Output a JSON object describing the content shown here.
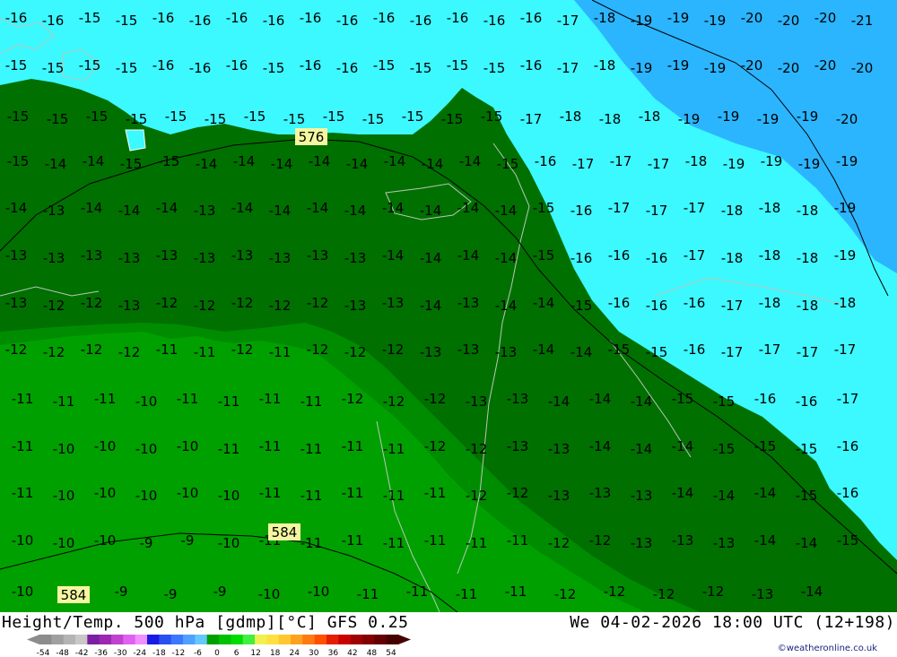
{
  "map": {
    "height_contours": [
      {
        "label": "576"
      },
      {
        "label": "584"
      },
      {
        "label": "584"
      }
    ],
    "temperature_labels": [
      "-16",
      "-16",
      "-15",
      "-15",
      "-16",
      "-16",
      "-16",
      "-16",
      "-16",
      "-16",
      "-16",
      "-16",
      "-16",
      "-16",
      "-16",
      "-17",
      "-18",
      "-19",
      "-19",
      "-19",
      "-20",
      "-20",
      "-20",
      "-21",
      "-15",
      "-15",
      "-15",
      "-15",
      "-16",
      "-16",
      "-16",
      "-15",
      "-16",
      "-16",
      "-15",
      "-15",
      "-15",
      "-15",
      "-16",
      "-17",
      "-18",
      "-19",
      "-19",
      "-19",
      "-20",
      "-20",
      "-20",
      "-20",
      "-15",
      "-15",
      "-15",
      "-15",
      "-15",
      "-15",
      "-15",
      "-15",
      "-15",
      "-15",
      "-15",
      "-15",
      "-15",
      "-17",
      "-18",
      "-18",
      "-18",
      "-19",
      "-19",
      "-19",
      "-19",
      "-20",
      "-15",
      "-14",
      "-14",
      "-15",
      "-15",
      "-14",
      "-14",
      "-14",
      "-14",
      "-14",
      "-14",
      "-14",
      "-14",
      "-15",
      "-16",
      "-17",
      "-17",
      "-17",
      "-18",
      "-19",
      "-19",
      "-19",
      "-19",
      "-14",
      "-13",
      "-14",
      "-14",
      "-14",
      "-13",
      "-14",
      "-14",
      "-14",
      "-14",
      "-14",
      "-14",
      "-14",
      "-14",
      "-15",
      "-16",
      "-17",
      "-17",
      "-17",
      "-18",
      "-18",
      "-18",
      "-19",
      "-13",
      "-13",
      "-13",
      "-13",
      "-13",
      "-13",
      "-13",
      "-13",
      "-13",
      "-13",
      "-14",
      "-14",
      "-14",
      "-14",
      "-15",
      "-16",
      "-16",
      "-16",
      "-17",
      "-18",
      "-18",
      "-18",
      "-19",
      "-13",
      "-12",
      "-12",
      "-13",
      "-12",
      "-12",
      "-12",
      "-12",
      "-12",
      "-13",
      "-13",
      "-14",
      "-13",
      "-14",
      "-14",
      "-15",
      "-16",
      "-16",
      "-16",
      "-17",
      "-18",
      "-18",
      "-18",
      "-12",
      "-12",
      "-12",
      "-12",
      "-11",
      "-11",
      "-12",
      "-11",
      "-12",
      "-12",
      "-12",
      "-13",
      "-13",
      "-13",
      "-14",
      "-14",
      "-15",
      "-15",
      "-16",
      "-17",
      "-17",
      "-17",
      "-17",
      "-11",
      "-11",
      "-11",
      "-10",
      "-11",
      "-11",
      "-11",
      "-11",
      "-12",
      "-12",
      "-12",
      "-13",
      "-13",
      "-14",
      "-14",
      "-14",
      "-15",
      "-15",
      "-16",
      "-16",
      "-17",
      "-11",
      "-10",
      "-10",
      "-10",
      "-10",
      "-11",
      "-11",
      "-11",
      "-11",
      "-11",
      "-12",
      "-12",
      "-13",
      "-13",
      "-14",
      "-14",
      "-14",
      "-15",
      "-15",
      "-15",
      "-16",
      "-11",
      "-10",
      "-10",
      "-10",
      "-10",
      "-10",
      "-11",
      "-11",
      "-11",
      "-11",
      "-11",
      "-12",
      "-12",
      "-13",
      "-13",
      "-13",
      "-14",
      "-14",
      "-14",
      "-15",
      "-16",
      "-10",
      "-10",
      "-10",
      "-9",
      "-9",
      "-10",
      "-11",
      "-11",
      "-11",
      "-11",
      "-11",
      "-11",
      "-11",
      "-12",
      "-12",
      "-13",
      "-13",
      "-13",
      "-14",
      "-14",
      "-15",
      "-10",
      "-10",
      "-9",
      "-9",
      "-9",
      "-10",
      "-10",
      "-11",
      "-11",
      "-11",
      "-11",
      "-12",
      "-12",
      "-12",
      "-12",
      "-13",
      "-14"
    ]
  },
  "footer": {
    "title": "Height/Temp. 500 hPa [gdmp][°C] GFS 0.25",
    "valid": "We 04-02-2026 18:00 UTC (12+198)",
    "credit": "©weatheronline.co.uk"
  },
  "colorscale": {
    "labels": [
      "-54",
      "-48",
      "-42",
      "-36",
      "-30",
      "-24",
      "-18",
      "-12",
      "-6",
      "0",
      "6",
      "12",
      "18",
      "24",
      "30",
      "36",
      "42",
      "48",
      "54"
    ],
    "colors": [
      "#8c8c8c",
      "#a0a0a0",
      "#b4b4b4",
      "#c8c8c8",
      "#7b1fa2",
      "#9c27b0",
      "#c040d0",
      "#e060f0",
      "#f090ff",
      "#1a1ae6",
      "#2850f0",
      "#3c78ff",
      "#50a0ff",
      "#64c8ff",
      "#00a000",
      "#00c000",
      "#00dc00",
      "#40f040",
      "#f0f050",
      "#ffe040",
      "#ffc830",
      "#ffa020",
      "#ff7a10",
      "#ff5000",
      "#e61e00",
      "#c80000",
      "#a00000",
      "#820000",
      "#640000",
      "#460000"
    ]
  }
}
